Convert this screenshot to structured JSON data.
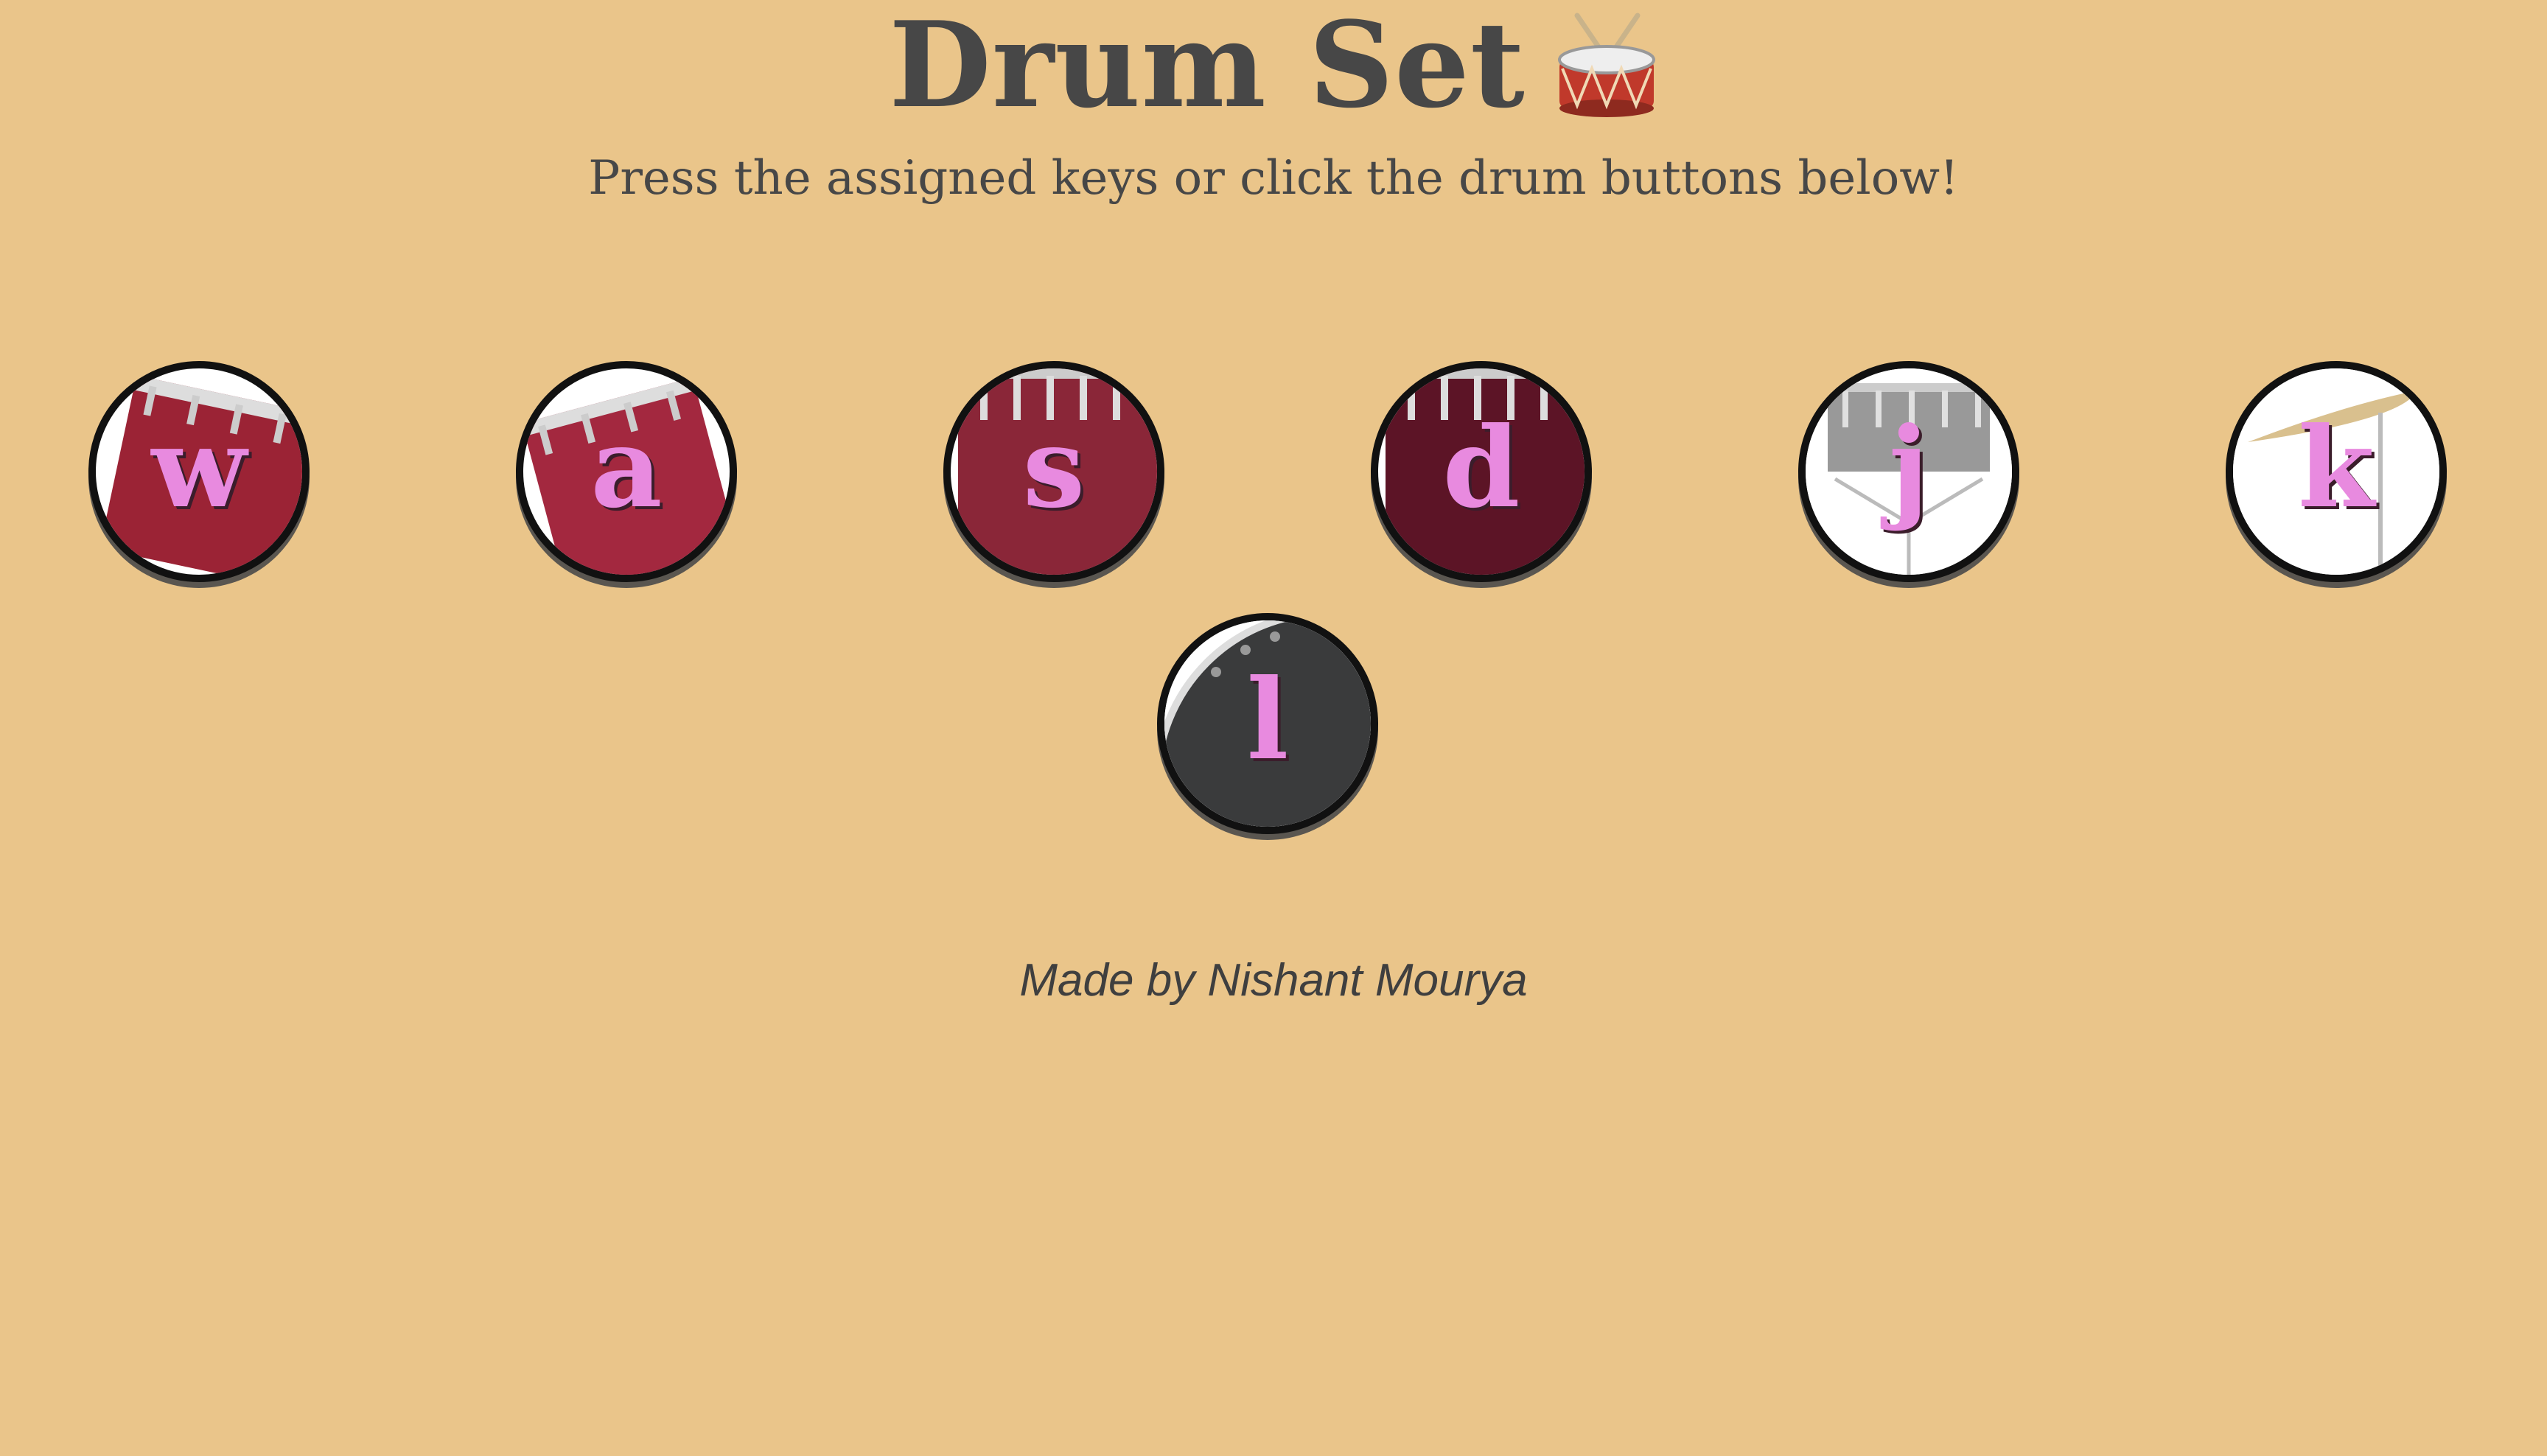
{
  "header": {
    "title": "Drum Set",
    "title_icon": "drum-emoji",
    "subtitle": "Press the assigned keys or click the drum buttons below!"
  },
  "drums": [
    {
      "key": "w",
      "icon": "tom-1"
    },
    {
      "key": "a",
      "icon": "tom-2"
    },
    {
      "key": "s",
      "icon": "tom-3"
    },
    {
      "key": "d",
      "icon": "tom-4"
    },
    {
      "key": "j",
      "icon": "snare"
    },
    {
      "key": "k",
      "icon": "crash"
    },
    {
      "key": "l",
      "icon": "kick"
    }
  ],
  "footer": {
    "credit": "Made by Nishant Mourya"
  },
  "colors": {
    "background": "#EAC58A",
    "key_letter": "#E88ADF",
    "text": "#474747"
  }
}
